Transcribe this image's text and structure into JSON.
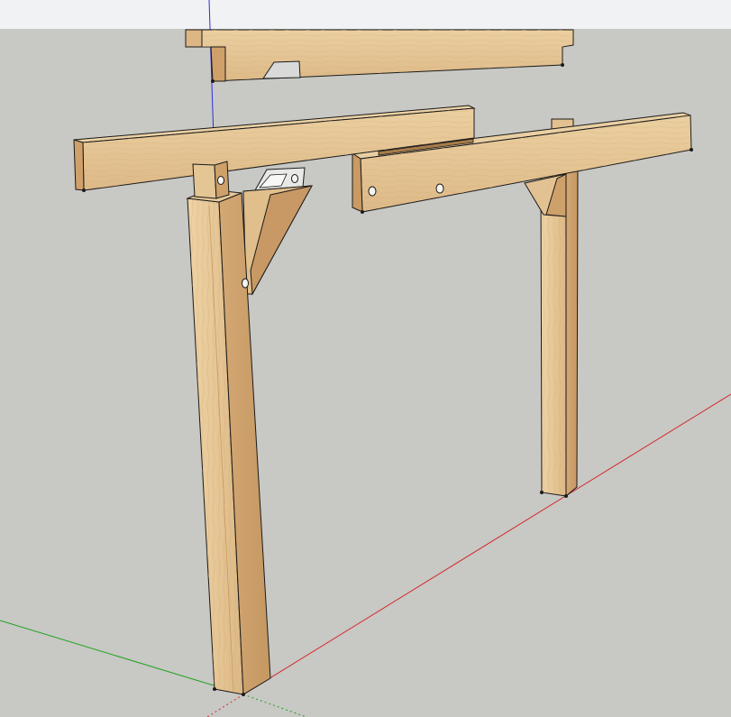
{
  "app": {
    "view": "3d-modeling-viewport"
  },
  "colors": {
    "sky": "#f1f2f4",
    "ground": "#c8c8c4",
    "wood_light": "#e8c99a",
    "wood_mid": "#dcb683",
    "wood_dark": "#c99a63",
    "wood_shadow": "#b8874f",
    "edge": "#1a1a1a",
    "axis_red": "#d22a2a",
    "axis_green": "#1fa31f",
    "axis_blue": "#2d2de0"
  },
  "model": {
    "components": [
      "top-beam",
      "left-tie-beam",
      "right-tie-beam",
      "front-left-post",
      "back-right-post",
      "left-knee-brace",
      "right-knee-brace",
      "metal-bracket"
    ]
  }
}
